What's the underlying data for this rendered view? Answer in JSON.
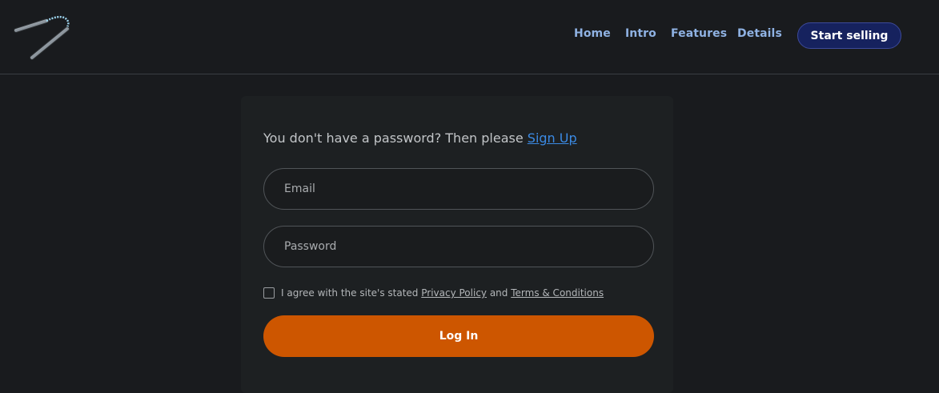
{
  "header": {
    "logo_icon": "nunchaku-icon",
    "nav": [
      {
        "label": "Home"
      },
      {
        "label": "Intro"
      },
      {
        "label": "Features"
      },
      {
        "label": "Details"
      }
    ],
    "cta_label": "Start selling"
  },
  "login": {
    "prompt_text": "You don't have a password? Then please ",
    "signup_link": "Sign Up",
    "email_placeholder": "Email",
    "password_placeholder": "Password",
    "agree_prefix": "I agree with the site's stated ",
    "privacy_link": "Privacy Policy",
    "agree_middle": " and ",
    "terms_link": "Terms & Conditions",
    "agree_checked": false,
    "submit_label": "Log In"
  },
  "colors": {
    "background": "#191b1e",
    "card": "#1d2022",
    "nav_link": "#8fb2e3",
    "cta_bg": "#16225e",
    "link": "#3b8ae4",
    "primary_button": "#cd5600"
  }
}
